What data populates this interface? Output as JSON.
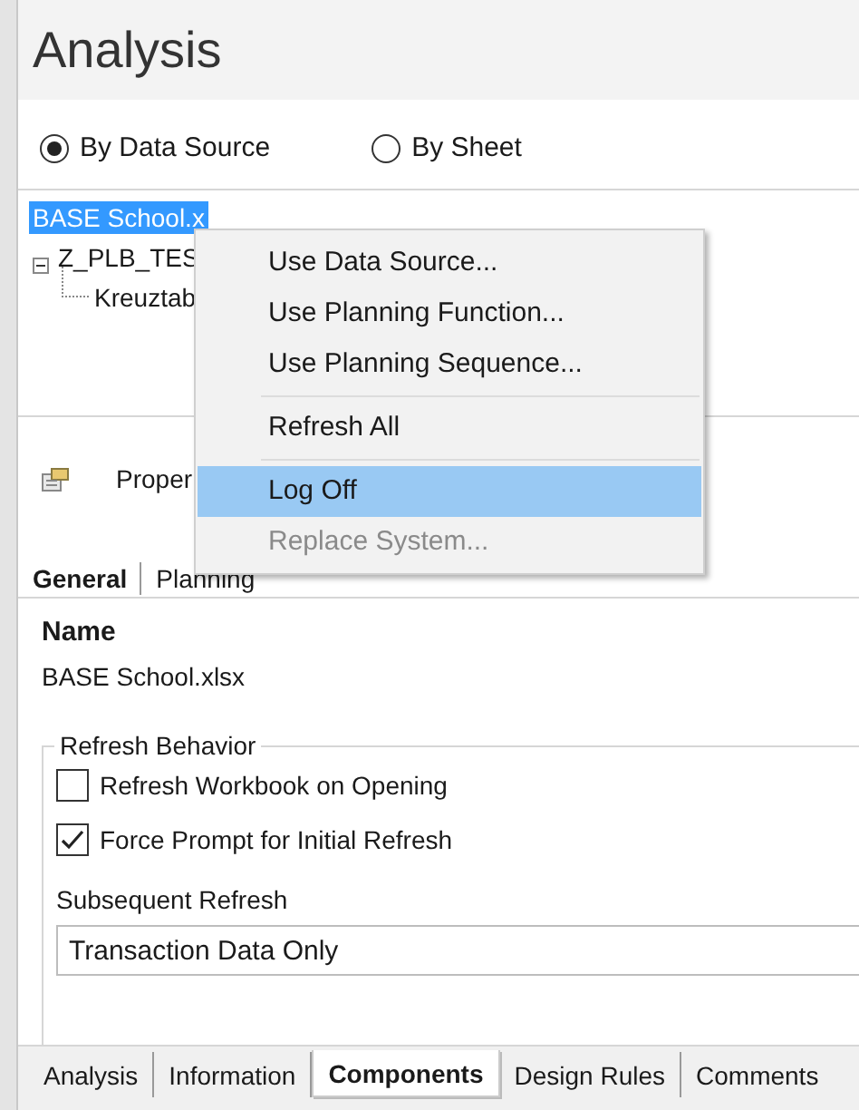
{
  "title": "Analysis",
  "view_options": [
    {
      "label": "By Data Source",
      "selected": true
    },
    {
      "label": "By Sheet",
      "selected": false
    }
  ],
  "tree": [
    {
      "label": "BASE School.x",
      "selected": true,
      "children": [
        {
          "label": "Z_PLB_TES",
          "selected": false,
          "expanded": true,
          "children": [
            {
              "label": "Kreuztab",
              "selected": false
            }
          ]
        }
      ]
    }
  ],
  "properties_label": "Proper",
  "detail_tabs": [
    {
      "label": "General",
      "selected": true
    },
    {
      "label": "Planning",
      "selected": false
    }
  ],
  "name_label": "Name",
  "name_value": "BASE School.xlsx",
  "refresh_behavior": {
    "legend": "Refresh Behavior",
    "options": [
      {
        "label": "Refresh Workbook on Opening",
        "checked": false
      },
      {
        "label": "Force Prompt for Initial Refresh",
        "checked": true
      }
    ],
    "subsequent_label": "Subsequent Refresh",
    "subsequent_value": "Transaction Data Only"
  },
  "bottom_tabs": [
    {
      "label": "Analysis",
      "selected": false
    },
    {
      "label": "Information",
      "selected": false
    },
    {
      "label": "Components",
      "selected": true
    },
    {
      "label": "Design Rules",
      "selected": false
    },
    {
      "label": "Comments",
      "selected": false
    }
  ],
  "context_menu": [
    {
      "kind": "item",
      "label": "Use Data Source...",
      "highlighted": false,
      "disabled": false
    },
    {
      "kind": "item",
      "label": "Use Planning Function...",
      "highlighted": false,
      "disabled": false
    },
    {
      "kind": "item",
      "label": "Use Planning Sequence...",
      "highlighted": false,
      "disabled": false
    },
    {
      "kind": "separator"
    },
    {
      "kind": "item",
      "label": "Refresh All",
      "highlighted": false,
      "disabled": false
    },
    {
      "kind": "separator"
    },
    {
      "kind": "item",
      "label": "Log Off",
      "highlighted": true,
      "disabled": false
    },
    {
      "kind": "item",
      "label": "Replace System...",
      "highlighted": false,
      "disabled": true
    }
  ]
}
